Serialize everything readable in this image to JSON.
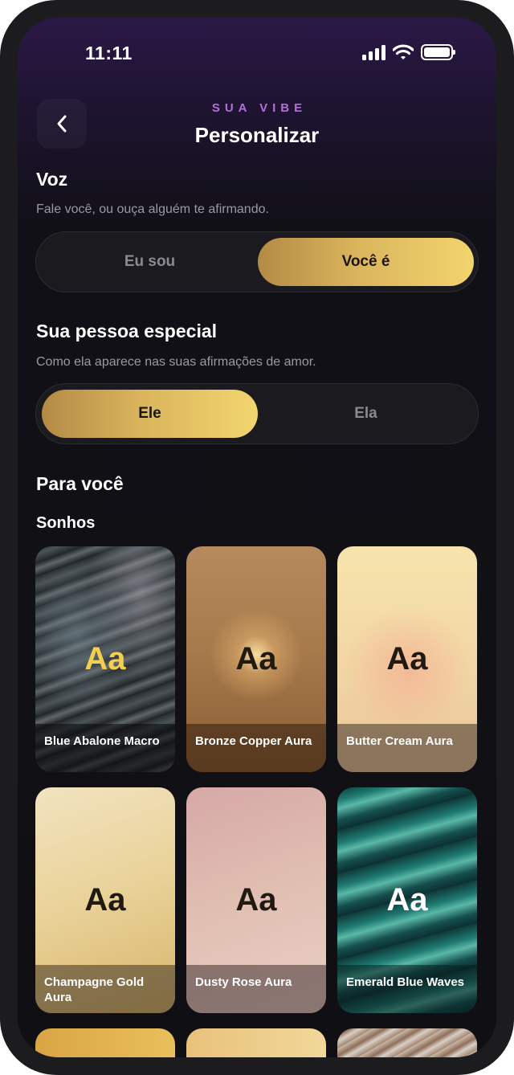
{
  "status": {
    "time": "11:11"
  },
  "header": {
    "eyebrow": "SUA VIBE",
    "title": "Personalizar"
  },
  "voice": {
    "title": "Voz",
    "description": "Fale você, ou ouça alguém te afirmando.",
    "options": [
      "Eu sou",
      "Você é"
    ],
    "selected": "Você é"
  },
  "special_person": {
    "title": "Sua pessoa especial",
    "description": "Como ela aparece nas suas afirmações de amor.",
    "options": [
      "Ele",
      "Ela"
    ],
    "selected": "Ele"
  },
  "for_you": {
    "title": "Para você",
    "subtitle": "Sonhos",
    "cards": [
      {
        "preview": "Aa",
        "name": "Blue Abalone Macro"
      },
      {
        "preview": "Aa",
        "name": "Bronze Copper Aura"
      },
      {
        "preview": "Aa",
        "name": "Butter Cream Aura"
      },
      {
        "preview": "Aa",
        "name": "Champagne Gold Aura"
      },
      {
        "preview": "Aa",
        "name": "Dusty Rose Aura"
      },
      {
        "preview": "Aa",
        "name": "Emerald Blue Waves"
      }
    ]
  },
  "colors": {
    "accent": "#b46fdc",
    "gold_start": "#b38a45",
    "gold_end": "#f2d56e",
    "background": "#101014"
  }
}
